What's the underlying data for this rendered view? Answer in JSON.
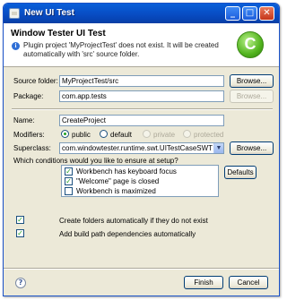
{
  "window": {
    "title": "New UI Test"
  },
  "titlebar_buttons": {
    "minimize": "_",
    "maximize": "□",
    "close": "✕"
  },
  "header": {
    "title": "Window Tester UI Test",
    "message": "Plugin project 'MyProjectTest' does not exist. It will be created automatically with 'src' source folder.",
    "info_icon": "i",
    "logo_letter": "C"
  },
  "source_folder": {
    "label": "Source folder:",
    "value": "MyProjectTest/src",
    "browse": "Browse..."
  },
  "package": {
    "label": "Package:",
    "value": "com.app.tests",
    "browse": "Browse..."
  },
  "name": {
    "label": "Name:",
    "value": "CreateProject"
  },
  "modifiers": {
    "label": "Modifiers:",
    "options": [
      "public",
      "default",
      "private",
      "protected"
    ],
    "selected": "public"
  },
  "superclass": {
    "label": "Superclass:",
    "value": "com.windowtester.runtime.swt.UITestCaseSWT",
    "browse": "Browse..."
  },
  "conditions": {
    "label": "Which conditions would you like to ensure at setup?",
    "items": [
      {
        "label": "Workbench has keyboard focus",
        "checked": true
      },
      {
        "label": "\"Welcome\" page is closed",
        "checked": true
      },
      {
        "label": "Workbench is maximized",
        "checked": false
      }
    ],
    "defaults_button": "Defaults"
  },
  "options": {
    "create_folders": "Create folders automatically if they do not exist",
    "add_dependencies": "Add build path dependencies automatically"
  },
  "footer": {
    "finish": "Finish",
    "cancel": "Cancel",
    "help_icon": "?"
  },
  "check_glyph": "✓"
}
